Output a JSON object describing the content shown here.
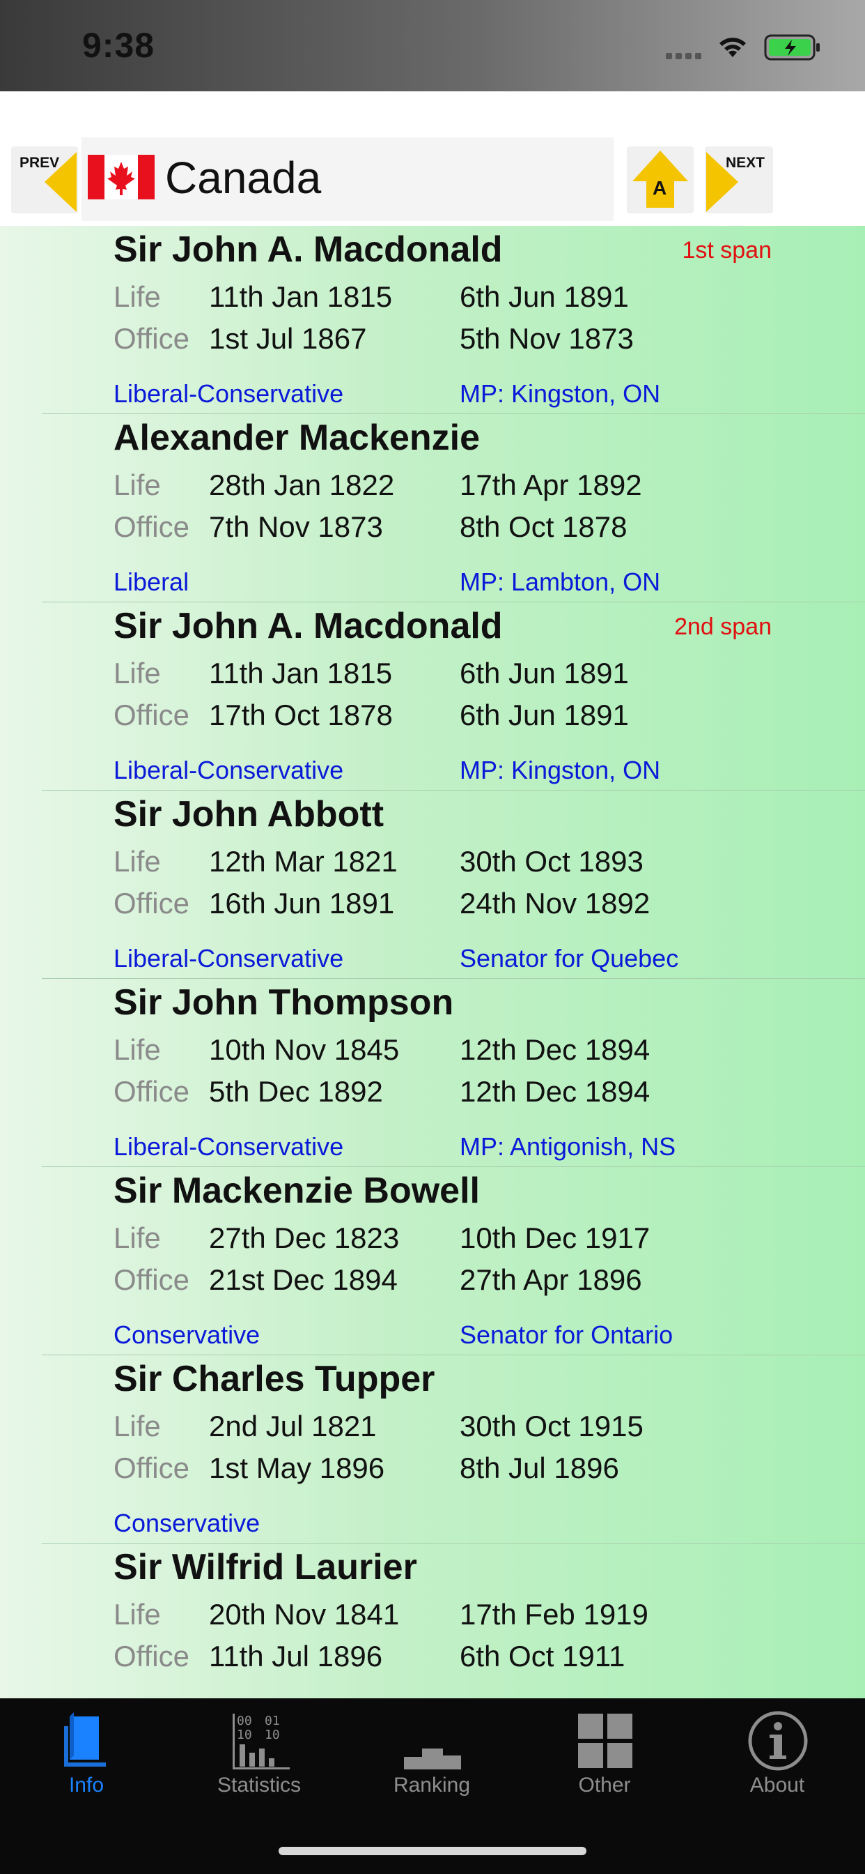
{
  "status_bar": {
    "time": "9:38"
  },
  "nav": {
    "prev_label": "PREV",
    "next_label": "NEXT",
    "sort_label": "A",
    "country": "Canada"
  },
  "entries": [
    {
      "name": "Sir John A. Macdonald",
      "span": "1st span",
      "life_label": "Life",
      "office_label": "Office",
      "life_start": "11th Jan 1815",
      "life_end": "6th Jun 1891",
      "office_start": "1st Jul 1867",
      "office_end": "5th Nov 1873",
      "party": "Liberal-Conservative",
      "seat": "MP: Kingston, ON"
    },
    {
      "name": "Alexander Mackenzie",
      "span": "",
      "life_label": "Life",
      "office_label": "Office",
      "life_start": "28th Jan 1822",
      "life_end": "17th Apr 1892",
      "office_start": "7th Nov 1873",
      "office_end": "8th Oct 1878",
      "party": "Liberal",
      "seat": "MP: Lambton, ON"
    },
    {
      "name": "Sir John A. Macdonald",
      "span": "2nd span",
      "life_label": "Life",
      "office_label": "Office",
      "life_start": "11th Jan 1815",
      "life_end": "6th Jun 1891",
      "office_start": "17th Oct 1878",
      "office_end": "6th Jun 1891",
      "party": "Liberal-Conservative",
      "seat": "MP: Kingston, ON"
    },
    {
      "name": "Sir John Abbott",
      "span": "",
      "life_label": "Life",
      "office_label": "Office",
      "life_start": "12th Mar 1821",
      "life_end": "30th Oct 1893",
      "office_start": "16th Jun 1891",
      "office_end": "24th Nov 1892",
      "party": "Liberal-Conservative",
      "seat": "Senator for Quebec"
    },
    {
      "name": "Sir John Thompson",
      "span": "",
      "life_label": "Life",
      "office_label": "Office",
      "life_start": "10th Nov 1845",
      "life_end": "12th Dec 1894",
      "office_start": "5th Dec 1892",
      "office_end": "12th Dec 1894",
      "party": "Liberal-Conservative",
      "seat": "MP: Antigonish, NS"
    },
    {
      "name": "Sir Mackenzie Bowell",
      "span": "",
      "life_label": "Life",
      "office_label": "Office",
      "life_start": "27th Dec 1823",
      "life_end": "10th Dec 1917",
      "office_start": "21st Dec 1894",
      "office_end": "27th Apr 1896",
      "party": "Conservative",
      "seat": "Senator for Ontario"
    },
    {
      "name": "Sir Charles Tupper",
      "span": "",
      "life_label": "Life",
      "office_label": "Office",
      "life_start": "2nd Jul 1821",
      "life_end": "30th Oct 1915",
      "office_start": "1st May 1896",
      "office_end": "8th Jul 1896",
      "party": "Conservative",
      "seat": ""
    },
    {
      "name": "Sir Wilfrid Laurier",
      "span": "",
      "life_label": "Life",
      "office_label": "Office",
      "life_start": "20th Nov 1841",
      "life_end": "17th Feb 1919",
      "office_start": "11th Jul 1896",
      "office_end": "6th Oct 1911",
      "party": "",
      "seat": ""
    }
  ],
  "tabs": [
    {
      "label": "Info",
      "icon": "book-icon",
      "active": true
    },
    {
      "label": "Statistics",
      "icon": "binary-chart-icon",
      "active": false
    },
    {
      "label": "Ranking",
      "icon": "podium-icon",
      "active": false
    },
    {
      "label": "Other",
      "icon": "grid-icon",
      "active": false
    },
    {
      "label": "About",
      "icon": "info-circle-icon",
      "active": false
    }
  ],
  "colors": {
    "accent": "#1a82ff",
    "party_text": "#0a1ad8",
    "span_text": "#e01010",
    "arrow": "#f5c400",
    "flag_red": "#e8101c"
  }
}
